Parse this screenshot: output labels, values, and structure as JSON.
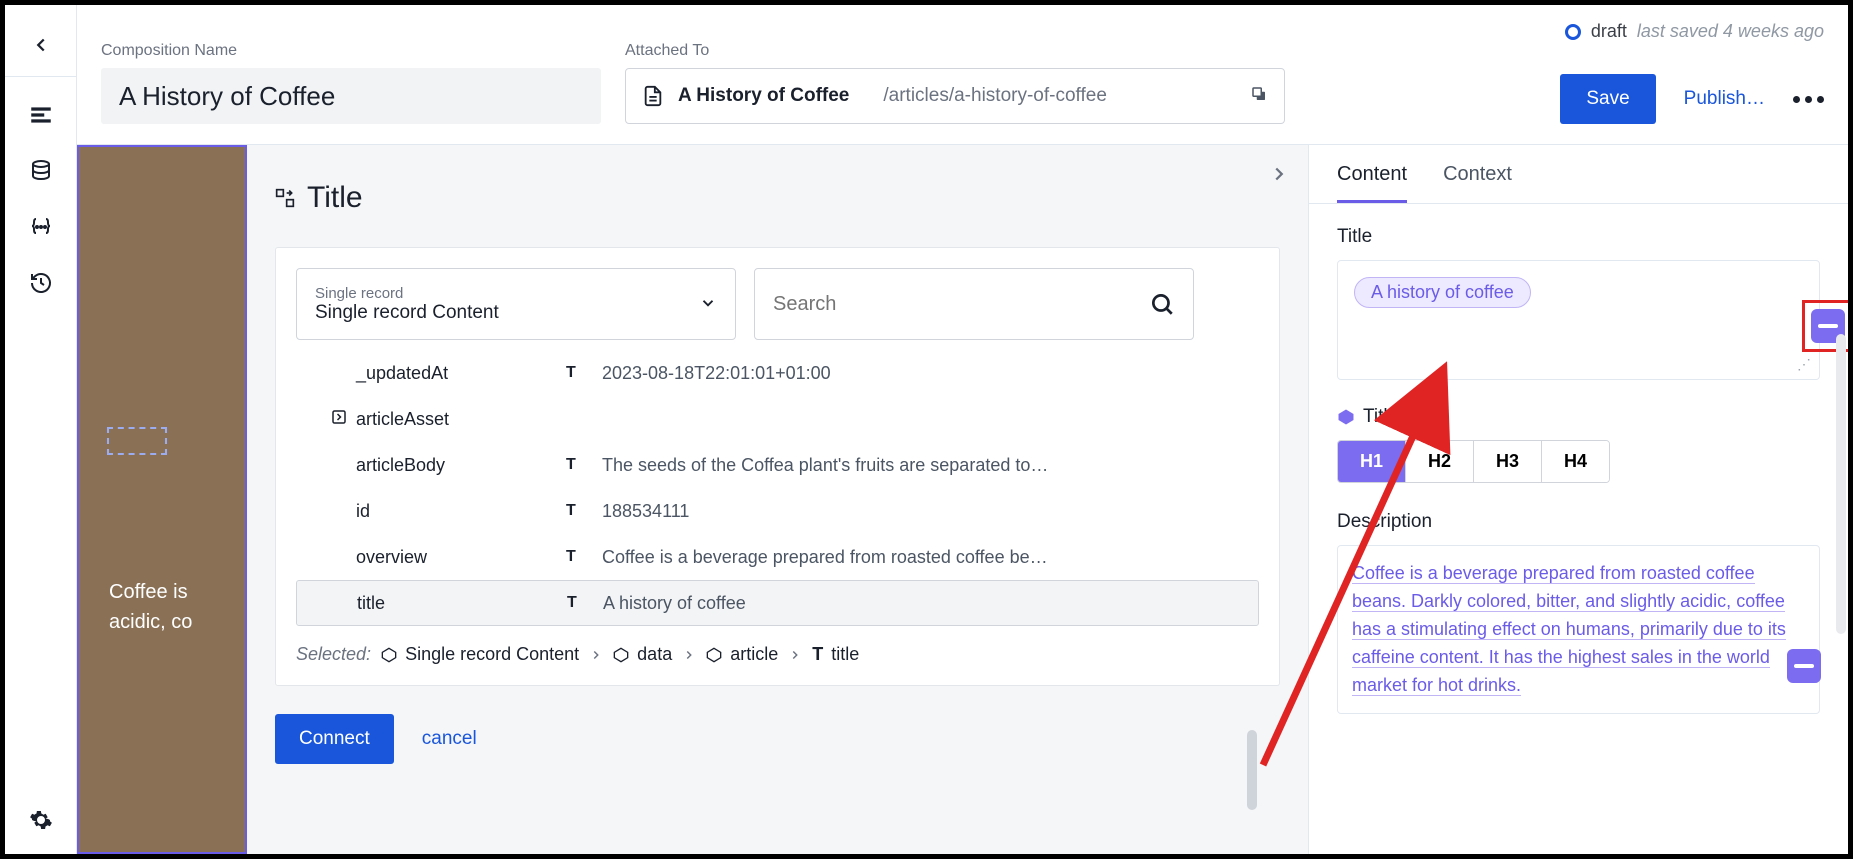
{
  "status": {
    "state": "draft",
    "saved": "last saved 4 weeks ago"
  },
  "composition": {
    "nameLabel": "Composition Name",
    "name": "A History of Coffee",
    "attachedLabel": "Attached To",
    "attachedTitle": "A History of Coffee",
    "attachedPath": "/articles/a-history-of-coffee"
  },
  "actions": {
    "save": "Save",
    "publish": "Publish…"
  },
  "modal": {
    "title": "Title",
    "selectLabel": "Single record",
    "selectValue": "Single record Content",
    "searchPlaceholder": "Search",
    "records": [
      {
        "key": "_updatedAt",
        "type": "T",
        "value": "2023-08-18T22:01:01+01:00",
        "icon": ""
      },
      {
        "key": "articleAsset",
        "type": "",
        "value": "",
        "icon": "ref"
      },
      {
        "key": "articleBody",
        "type": "T",
        "value": "The seeds of the Coffea plant's fruits are separated to…",
        "icon": ""
      },
      {
        "key": "id",
        "type": "T",
        "value": "188534111",
        "icon": ""
      },
      {
        "key": "overview",
        "type": "T",
        "value": "Coffee is a beverage prepared from roasted coffee be…",
        "icon": ""
      },
      {
        "key": "title",
        "type": "T",
        "value": "A history of coffee",
        "icon": "",
        "selected": true
      }
    ],
    "selectedLabel": "Selected:",
    "path": [
      "Single record Content",
      "data",
      "article",
      "title"
    ],
    "connect": "Connect",
    "cancel": "cancel"
  },
  "rightPanel": {
    "tabs": {
      "content": "Content",
      "context": "Context"
    },
    "titleLabel": "Title",
    "titleChip": "A history of coffee",
    "styleLabel": "Title Style",
    "headings": [
      "H1",
      "H2",
      "H3",
      "H4"
    ],
    "descLabel": "Description",
    "descText": "Coffee is a beverage prepared from roasted coffee beans. Darkly colored, bitter, and slightly acidic, coffee has a stimulating effect on humans, primarily due to its caffeine content. It has the highest sales in the world market for hot drinks."
  },
  "canvas": {
    "line1": "Coffee is",
    "line2": "acidic, co"
  }
}
